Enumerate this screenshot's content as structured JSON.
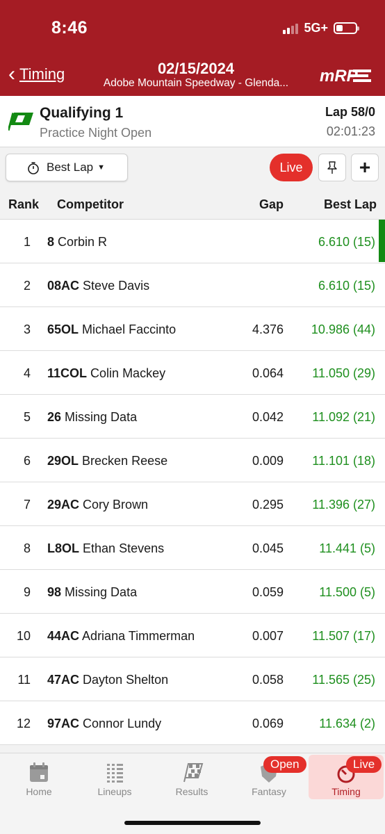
{
  "status": {
    "time": "8:46",
    "network": "5G+"
  },
  "header": {
    "back_label": "Timing",
    "date": "02/15/2024",
    "venue": "Adobe Mountain Speedway - Glenda..."
  },
  "session": {
    "title": "Qualifying 1",
    "subtitle": "Practice Night Open",
    "lap": "Lap 58/0",
    "clock": "02:01:23"
  },
  "toolbar": {
    "sort_label": "Best Lap",
    "live_label": "Live"
  },
  "columns": {
    "rank": "Rank",
    "competitor": "Competitor",
    "gap": "Gap",
    "best": "Best Lap"
  },
  "rows": [
    {
      "rank": "1",
      "num": "8",
      "name": "Corbin R",
      "gap": "",
      "best": "6.610 (15)"
    },
    {
      "rank": "2",
      "num": "08AC",
      "name": "Steve Davis",
      "gap": "",
      "best": "6.610 (15)"
    },
    {
      "rank": "3",
      "num": "65OL",
      "name": "Michael Faccinto",
      "gap": "4.376",
      "best": "10.986 (44)"
    },
    {
      "rank": "4",
      "num": "11COL",
      "name": "Colin Mackey",
      "gap": "0.064",
      "best": "11.050 (29)"
    },
    {
      "rank": "5",
      "num": "26",
      "name": "Missing Data",
      "gap": "0.042",
      "best": "11.092 (21)"
    },
    {
      "rank": "6",
      "num": "29OL",
      "name": "Brecken Reese",
      "gap": "0.009",
      "best": "11.101 (18)"
    },
    {
      "rank": "7",
      "num": "29AC",
      "name": "Cory Brown",
      "gap": "0.295",
      "best": "11.396 (27)"
    },
    {
      "rank": "8",
      "num": "L8OL",
      "name": "Ethan Stevens",
      "gap": "0.045",
      "best": "11.441 (5)"
    },
    {
      "rank": "9",
      "num": "98",
      "name": "Missing Data",
      "gap": "0.059",
      "best": "11.500 (5)"
    },
    {
      "rank": "10",
      "num": "44AC",
      "name": "Adriana Timmerman",
      "gap": "0.007",
      "best": "11.507 (17)"
    },
    {
      "rank": "11",
      "num": "47AC",
      "name": "Dayton Shelton",
      "gap": "0.058",
      "best": "11.565 (25)"
    },
    {
      "rank": "12",
      "num": "97AC",
      "name": "Connor Lundy",
      "gap": "0.069",
      "best": "11.634 (2)"
    }
  ],
  "tabs": [
    {
      "label": "Home",
      "icon": "calendar-icon"
    },
    {
      "label": "Lineups",
      "icon": "list-icon"
    },
    {
      "label": "Results",
      "icon": "checkered-flag-icon"
    },
    {
      "label": "Fantasy",
      "icon": "shield-icon",
      "badge": "Open"
    },
    {
      "label": "Timing",
      "icon": "stopwatch-icon",
      "badge": "Live",
      "active": true
    }
  ],
  "colors": {
    "brand": "#a51c24",
    "live": "#e4302b",
    "best_lap": "#1e8f1e",
    "flag": "#138a13"
  }
}
